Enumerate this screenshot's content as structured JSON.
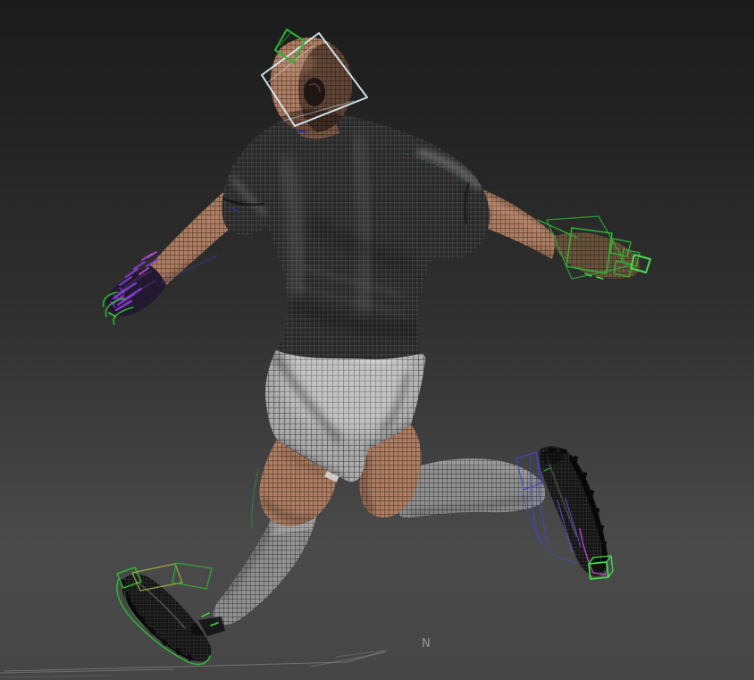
{
  "viewport": {
    "compass_label": "N"
  },
  "colors": {
    "bg_top": "#1b1b1b",
    "bg_mid": "#2f2f2f",
    "bg_bottom": "#4a4a4a",
    "bg_corner": "#464646",
    "ground_line": "#9b9b9b",
    "label_text": "#979797",
    "skin_base": "#aa7a60",
    "skin_line": "#2b1c13",
    "jersey_base": "#373737",
    "jersey_line": "#0a0a0a",
    "shorts_base": "#a8a8a8",
    "shorts_line": "#151515",
    "sock_base": "#909090",
    "sock_line": "#161616",
    "boot_base": "#151515",
    "boot_line": "#565656",
    "ctrl_white_blue": "#d8ebf3",
    "ctrl_green": "#2fb335",
    "ctrl_green_bright": "#44e04a",
    "ctrl_yellow_green": "#a9b545",
    "ctrl_purple": "#8a3fd8",
    "ctrl_magenta": "#c44ad0",
    "ctrl_blue": "#4547cf",
    "ctrl_violet": "#6a52d8",
    "ctrl_blue_deep": "#2b2bb0",
    "hand_shadow": "#221830"
  },
  "scene": {
    "model": "soccer-player-wireframe-mesh",
    "rig_controls": [
      {
        "name": "head-box-control",
        "color": "#d8ebf3"
      },
      {
        "name": "head-top-box-control",
        "color": "#2fb335"
      },
      {
        "name": "left-hand-finger-controls",
        "color": "#8a3fd8"
      },
      {
        "name": "left-hand-curve-controls",
        "color": "#2fb335"
      },
      {
        "name": "right-hand-box-controls",
        "color": "#2fb335"
      },
      {
        "name": "left-foot-box-controls",
        "color": "#2fb335"
      },
      {
        "name": "left-foot-sole-curve-control",
        "color": "#2fb335"
      },
      {
        "name": "right-foot-line-controls",
        "color": "#4547cf"
      },
      {
        "name": "right-foot-magenta-control",
        "color": "#c44ad0"
      },
      {
        "name": "right-foot-toe-cube-control",
        "color": "#44e04a"
      }
    ]
  }
}
